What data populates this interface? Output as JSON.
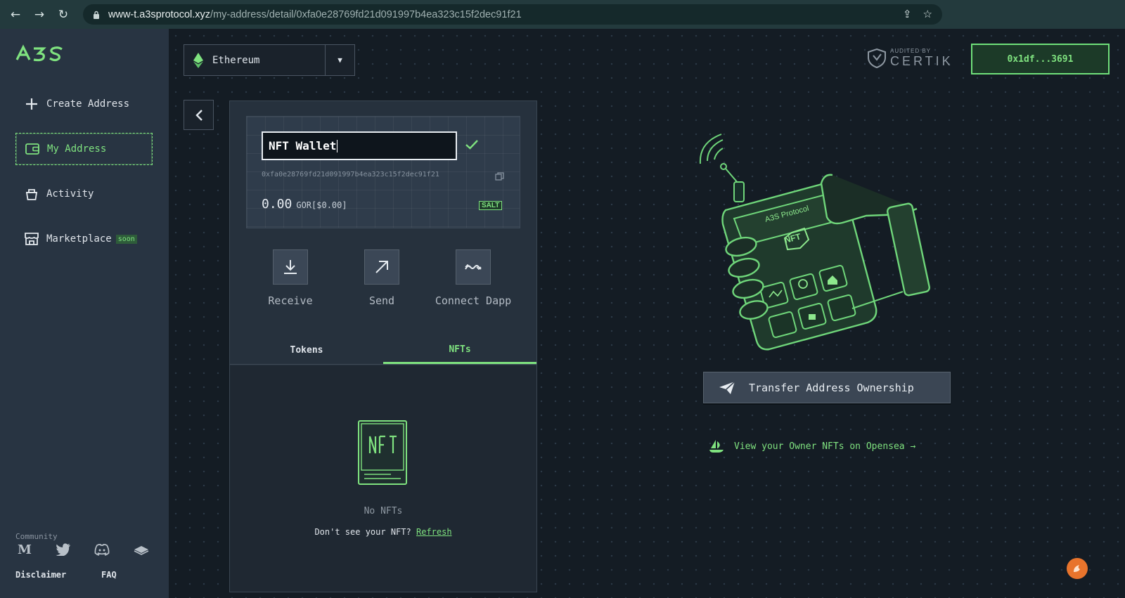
{
  "browser": {
    "url_host": "www-t.a3sprotocol.xyz",
    "url_path": "/my-address/detail/0xfa0e28769fd21d091997b4ea323c15f2dec91f21"
  },
  "sidebar": {
    "items": [
      {
        "label": "Create Address",
        "icon": "plus-icon"
      },
      {
        "label": "My Address",
        "icon": "wallet-icon"
      },
      {
        "label": "Activity",
        "icon": "basket-icon"
      },
      {
        "label": "Marketplace",
        "icon": "store-icon",
        "badge": "soon"
      }
    ],
    "community_label": "Community",
    "social_icons": [
      "medium-icon",
      "twitter-icon",
      "discord-icon",
      "docs-icon"
    ],
    "footer": {
      "disclaimer": "Disclaimer",
      "faq": "FAQ"
    }
  },
  "header": {
    "network": "Ethereum",
    "audit_small": "AUDITED BY",
    "audit_brand": "CERTIK",
    "account": "0x1df...3691"
  },
  "wallet": {
    "name": "NFT Wallet",
    "address": "0xfa0e28769fd21d091997b4ea323c15f2dec91f21",
    "balance": "0.00",
    "unit": "GOR[$0.00]",
    "badge": "SALT",
    "actions": [
      {
        "label": "Receive",
        "icon": "download-icon"
      },
      {
        "label": "Send",
        "icon": "arrow-up-right-icon"
      },
      {
        "label": "Connect Dapp",
        "icon": "connect-icon"
      }
    ],
    "tabs": [
      "Tokens",
      "NFTs"
    ],
    "active_tab": "NFTs",
    "empty_title": "No NFTs",
    "empty_prompt": "Don't see your NFT?",
    "refresh": "Refresh"
  },
  "right_panel": {
    "device_label": "A3S Protocol",
    "device_badge": "NFT",
    "transfer_button": "Transfer Address Ownership",
    "opensea_link": "View your Owner NFTs on Opensea →"
  },
  "colors": {
    "accent": "#7fe27f",
    "sidebar_bg": "#283442",
    "main_bg": "#141c24"
  }
}
